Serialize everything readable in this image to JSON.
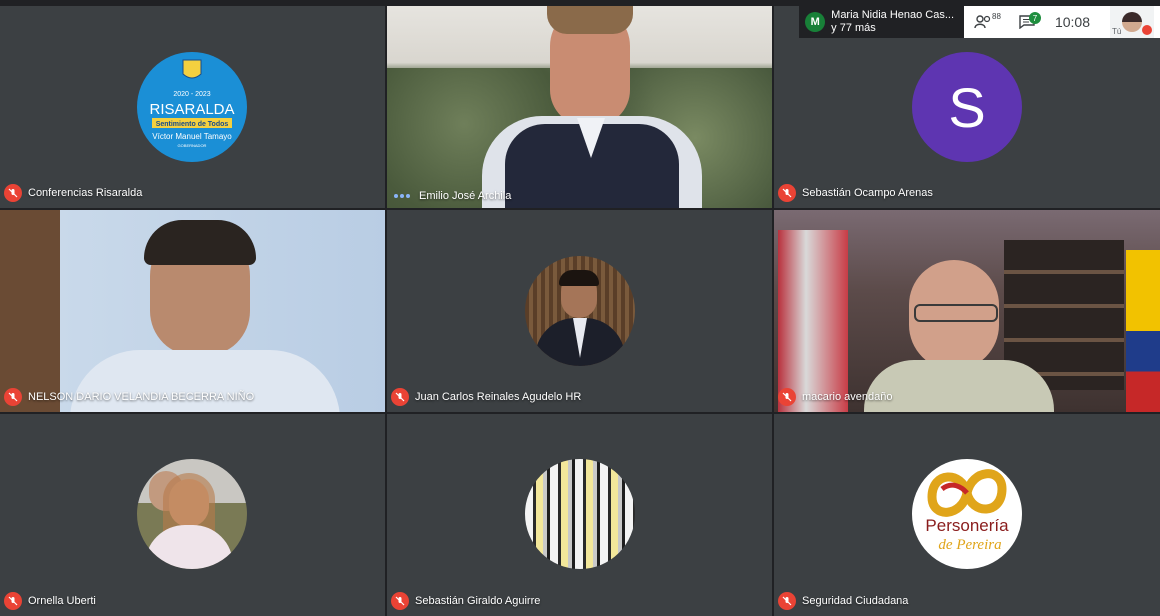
{
  "topbar": {
    "presenter_initial": "M",
    "presenter_name": "Maria Nidia Henao Cas...",
    "presenter_more": "y 77 más",
    "people_count": "88",
    "chat_count": "7",
    "time": "10:08",
    "self_label": "Tú"
  },
  "tiles": [
    {
      "name": "Conferencias Risaralda"
    },
    {
      "name": "Emilio José Archila"
    },
    {
      "name": "Sebastián Ocampo Arenas",
      "initial": "S"
    },
    {
      "name": "NELSON DARIO VELANDIA BECERRA NIÑO"
    },
    {
      "name": "Juan Carlos Reinales Agudelo HR"
    },
    {
      "name": "macario avendaño"
    },
    {
      "name": "Ornella Uberti"
    },
    {
      "name": "Sebastián Giraldo Aguirre"
    },
    {
      "name": "Seguridad Ciudadana"
    }
  ],
  "risaralda_logo": {
    "years": "2020 - 2023",
    "title": "RISARALDA",
    "slogan": "Sentimiento de Todos",
    "person": "Víctor Manuel Tamayo",
    "role": "GOBERNADOR"
  },
  "personeria_logo": {
    "line1": "Personería",
    "line2": "de Pereira"
  }
}
